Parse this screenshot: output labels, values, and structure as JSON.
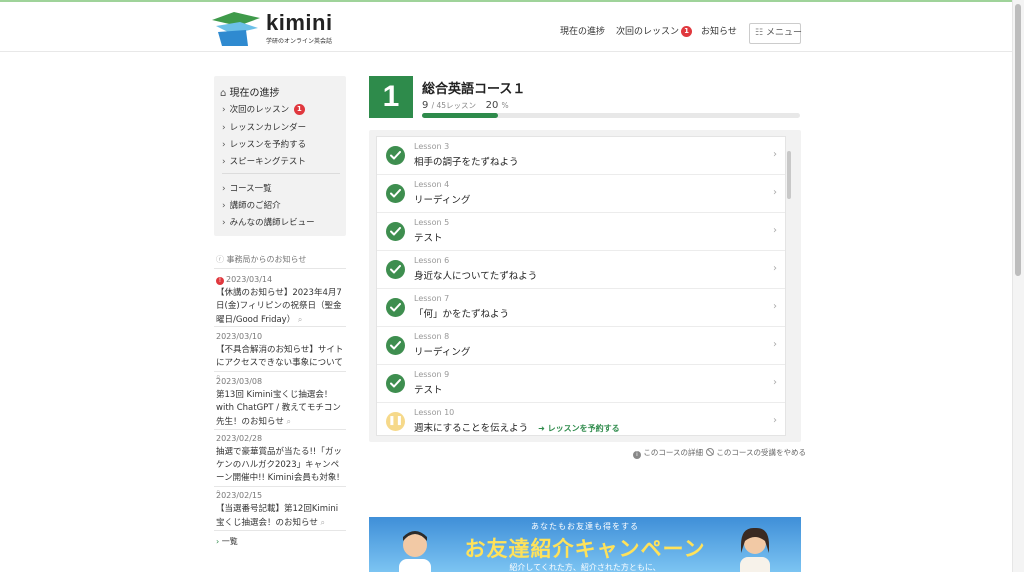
{
  "header": {
    "logo_text": "kimini",
    "logo_sub": "学研のオンライン英会話",
    "nav": {
      "progress": "現在の進捗",
      "next_lesson": "次回のレッスン",
      "next_lesson_badge": "1",
      "news": "お知らせ",
      "menu": "メニュー"
    }
  },
  "sidebar": {
    "title": "現在の進捗",
    "items": [
      {
        "label": "次回のレッスン",
        "badge": "1"
      },
      {
        "label": "レッスンカレンダー"
      },
      {
        "label": "レッスンを予約する"
      },
      {
        "label": "スピーキングテスト"
      },
      {
        "label": "コース一覧"
      },
      {
        "label": "講師のご紹介"
      },
      {
        "label": "みんなの講師レビュー"
      }
    ],
    "news_heading": "事務局からのお知らせ",
    "news": [
      {
        "date": "2023/03/14",
        "text": "【休講のお知らせ】2023年4月7日(金)フィリピンの祝祭日（聖金曜日/Good Friday）",
        "alert": "!"
      },
      {
        "date": "2023/03/10",
        "text": "【不具合解消のお知らせ】サイトにアクセスできない事象について"
      },
      {
        "date": "2023/03/08",
        "text": "第13回 Kimini宝くじ抽選会！with ChatGPT / 教えてモチコン先生！のお知らせ"
      },
      {
        "date": "2023/02/28",
        "text": "抽選で豪華賞品が当たる!!「ガッケンのハルガク2023」キャンペーン開催中!! Kimini会員も対象!"
      },
      {
        "date": "2023/02/15",
        "text": "【当選番号記載】第12回Kimini宝くじ抽選会！のお知らせ"
      }
    ],
    "news_more": "一覧"
  },
  "course": {
    "number": "1",
    "title": "総合英語コース１",
    "done": "9",
    "total": "/ 45レッスン",
    "percent": "20",
    "percent_unit": "%",
    "progress_fraction": 0.2,
    "links": {
      "details": "このコースの詳細",
      "quit": "このコースの受講をやめる"
    }
  },
  "lessons": [
    {
      "num": "Lesson 3",
      "name": "相手の調子をたずねよう",
      "status": "done"
    },
    {
      "num": "Lesson 4",
      "name": "リーディング",
      "status": "done"
    },
    {
      "num": "Lesson 5",
      "name": "テスト",
      "status": "done"
    },
    {
      "num": "Lesson 6",
      "name": "身近な人についてたずねよう",
      "status": "done"
    },
    {
      "num": "Lesson 7",
      "name": "「何」かをたずねよう",
      "status": "done"
    },
    {
      "num": "Lesson 8",
      "name": "リーディング",
      "status": "done"
    },
    {
      "num": "Lesson 9",
      "name": "テスト",
      "status": "done"
    },
    {
      "num": "Lesson 10",
      "name": "週末にすることを伝えよう",
      "status": "next",
      "book": "レッスンを予約する"
    }
  ],
  "banner": {
    "top": "あなたもお友達も得をする",
    "main": "お友達紹介キャンペーン",
    "sub": "紹介してくれた方、紹介された方ともに、"
  },
  "colors": {
    "brand_green": "#2e8b4b",
    "alert_red": "#e0383e",
    "pending_yellow": "#f6d98a"
  }
}
